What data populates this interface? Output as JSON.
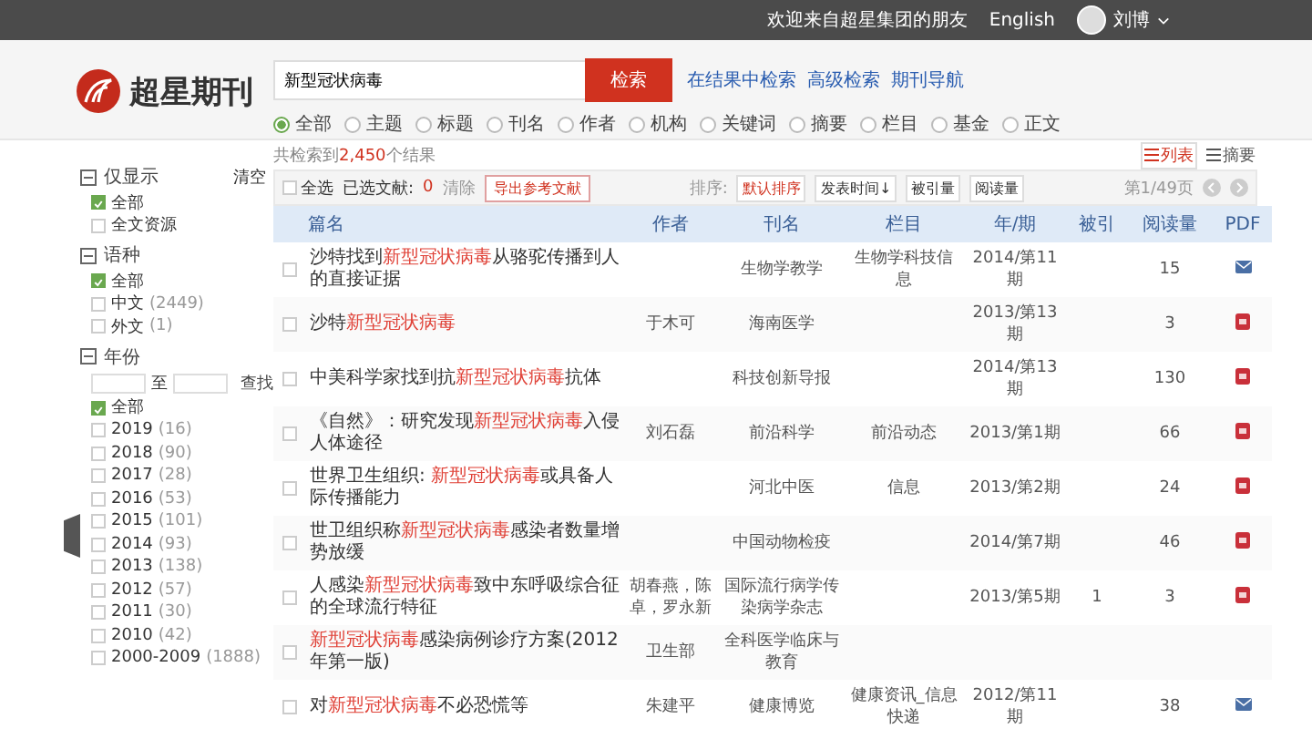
{
  "top_bar": {
    "welcome": "欢迎来自超星集团的朋友",
    "language": "English",
    "user": "刘博"
  },
  "logo": {
    "text": "超星期刊"
  },
  "search": {
    "value": "新型冠状病毒",
    "button": "检索",
    "links": [
      "在结果中检索",
      "高级检索",
      "期刊导航"
    ],
    "scopes": [
      {
        "label": "全部",
        "selected": true
      },
      {
        "label": "主题",
        "selected": false
      },
      {
        "label": "标题",
        "selected": false
      },
      {
        "label": "刊名",
        "selected": false
      },
      {
        "label": "作者",
        "selected": false
      },
      {
        "label": "机构",
        "selected": false
      },
      {
        "label": "关键词",
        "selected": false
      },
      {
        "label": "摘要",
        "selected": false
      },
      {
        "label": "栏目",
        "selected": false
      },
      {
        "label": "基金",
        "selected": false
      },
      {
        "label": "正文",
        "selected": false
      }
    ]
  },
  "sidebar": {
    "clear": "清空",
    "groups": [
      {
        "title": "仅显示",
        "expanded": true,
        "items": [
          {
            "label": "全部",
            "checked": true
          },
          {
            "label": "全文资源",
            "checked": false
          }
        ]
      },
      {
        "title": "语种",
        "expanded": true,
        "items": [
          {
            "label": "全部",
            "checked": true
          },
          {
            "label": "中文",
            "count": "(2449)",
            "checked": false
          },
          {
            "label": "外文",
            "count": "(1)",
            "checked": false
          }
        ]
      },
      {
        "title": "年份",
        "expanded": true,
        "range": {
          "separator": "至",
          "button": "查找"
        },
        "items": [
          {
            "label": "全部",
            "checked": true
          },
          {
            "label": "2019",
            "count": "(16)",
            "checked": false
          },
          {
            "label": "2018",
            "count": "(90)",
            "checked": false
          },
          {
            "label": "2017",
            "count": "(28)",
            "checked": false
          },
          {
            "label": "2016",
            "count": "(53)",
            "checked": false
          },
          {
            "label": "2015",
            "count": "(101)",
            "checked": false
          },
          {
            "label": "2014",
            "count": "(93)",
            "checked": false
          },
          {
            "label": "2013",
            "count": "(138)",
            "checked": false
          },
          {
            "label": "2012",
            "count": "(57)",
            "checked": false
          },
          {
            "label": "2011",
            "count": "(30)",
            "checked": false
          },
          {
            "label": "2010",
            "count": "(42)",
            "checked": false
          },
          {
            "label": "2000-2009",
            "count": "(1888)",
            "checked": false
          }
        ]
      }
    ]
  },
  "results": {
    "summary": [
      {
        "text": "共检索到",
        "hit": false
      },
      {
        "text": "2,450",
        "hit": true
      },
      {
        "text": "个结果",
        "hit": false
      }
    ],
    "views": [
      {
        "label": "列表",
        "selected": true
      },
      {
        "label": "摘要",
        "selected": false
      }
    ],
    "toolbar": {
      "select_all": "全选",
      "selected_label": "已选文献:",
      "selected_count": "0",
      "select_all_checked": false,
      "clear": "清除",
      "export": "导出参考文献",
      "sort_label": "排序:",
      "sorts": [
        {
          "label": "默认排序",
          "selected": true
        },
        {
          "label": "发表时间↓",
          "selected": false
        },
        {
          "label": "被引量",
          "selected": false
        },
        {
          "label": "阅读量",
          "selected": false
        }
      ],
      "page": "第1/49页"
    },
    "columns": [
      "篇名",
      "作者",
      "刊名",
      "栏目",
      "年/期",
      "被引",
      "阅读量",
      "PDF"
    ],
    "rows": [
      {
        "title": [
          {
            "text": "沙特找到",
            "hit": false
          },
          {
            "text": "新型冠状病毒",
            "hit": true
          },
          {
            "text": "从骆驼传播到人的直接证据",
            "hit": false
          }
        ],
        "author": "",
        "journal": "生物学教学",
        "section": "生物学科技信息",
        "issue": "2014/第11期",
        "cited": "",
        "reads": "15",
        "checked": false,
        "pdf": {
          "kind": "mail"
        }
      },
      {
        "title": [
          {
            "text": "沙特",
            "hit": false
          },
          {
            "text": "新型冠状病毒",
            "hit": true
          }
        ],
        "author": "于木可",
        "journal": "海南医学",
        "section": "",
        "issue": "2013/第13期",
        "cited": "",
        "reads": "3",
        "checked": false,
        "pdf": {
          "kind": "file"
        }
      },
      {
        "title": [
          {
            "text": "中美科学家找到抗",
            "hit": false
          },
          {
            "text": "新型冠状病毒",
            "hit": true
          },
          {
            "text": "抗体",
            "hit": false
          }
        ],
        "author": "",
        "journal": "科技创新导报",
        "section": "",
        "issue": "2014/第13期",
        "cited": "",
        "reads": "130",
        "checked": false,
        "pdf": {
          "kind": "file"
        }
      },
      {
        "title": [
          {
            "text": "《自然》：研究发现",
            "hit": false
          },
          {
            "text": "新型冠状病毒",
            "hit": true
          },
          {
            "text": "入侵人体途径",
            "hit": false
          }
        ],
        "author": "刘石磊",
        "journal": "前沿科学",
        "section": "前沿动态",
        "issue": "2013/第1期",
        "cited": "",
        "reads": "66",
        "checked": false,
        "pdf": {
          "kind": "file"
        }
      },
      {
        "title": [
          {
            "text": "世界卫生组织: ",
            "hit": false
          },
          {
            "text": "新型冠状病毒",
            "hit": true
          },
          {
            "text": "或具备人际传播能力",
            "hit": false
          }
        ],
        "author": "",
        "journal": "河北中医",
        "section": "信息",
        "issue": "2013/第2期",
        "cited": "",
        "reads": "24",
        "checked": false,
        "pdf": {
          "kind": "file"
        }
      },
      {
        "title": [
          {
            "text": "世卫组织称",
            "hit": false
          },
          {
            "text": "新型冠状病毒",
            "hit": true
          },
          {
            "text": "感染者数量增势放缓",
            "hit": false
          }
        ],
        "author": "",
        "journal": "中国动物检疫",
        "section": "",
        "issue": "2014/第7期",
        "cited": "",
        "reads": "46",
        "checked": false,
        "pdf": {
          "kind": "file"
        }
      },
      {
        "title": [
          {
            "text": "人感染",
            "hit": false
          },
          {
            "text": "新型冠状病毒",
            "hit": true
          },
          {
            "text": "致中东呼吸综合征的全球流行特征",
            "hit": false
          }
        ],
        "author": "胡春燕，陈卓，罗永新",
        "journal": "国际流行病学传染病学杂志",
        "section": "",
        "issue": "2013/第5期",
        "cited": "1",
        "reads": "3",
        "checked": false,
        "pdf": {
          "kind": "file"
        }
      },
      {
        "title": [
          {
            "text": "新型冠状病毒",
            "hit": true
          },
          {
            "text": "感染病例诊疗方案(2012年第一版)",
            "hit": false
          }
        ],
        "author": "卫生部",
        "journal": "全科医学临床与教育",
        "section": "",
        "issue": "",
        "cited": "",
        "checked": false
      },
      {
        "title": [
          {
            "text": "对",
            "hit": false
          },
          {
            "text": "新型冠状病毒",
            "hit": true
          },
          {
            "text": "不必恐慌等",
            "hit": false
          }
        ],
        "author": "朱建平",
        "journal": "健康博览",
        "section": "健康资讯_信息快递",
        "issue": "2012/第11期",
        "cited": "",
        "reads": "38",
        "checked": false,
        "pdf": {
          "kind": "mail"
        }
      }
    ]
  }
}
